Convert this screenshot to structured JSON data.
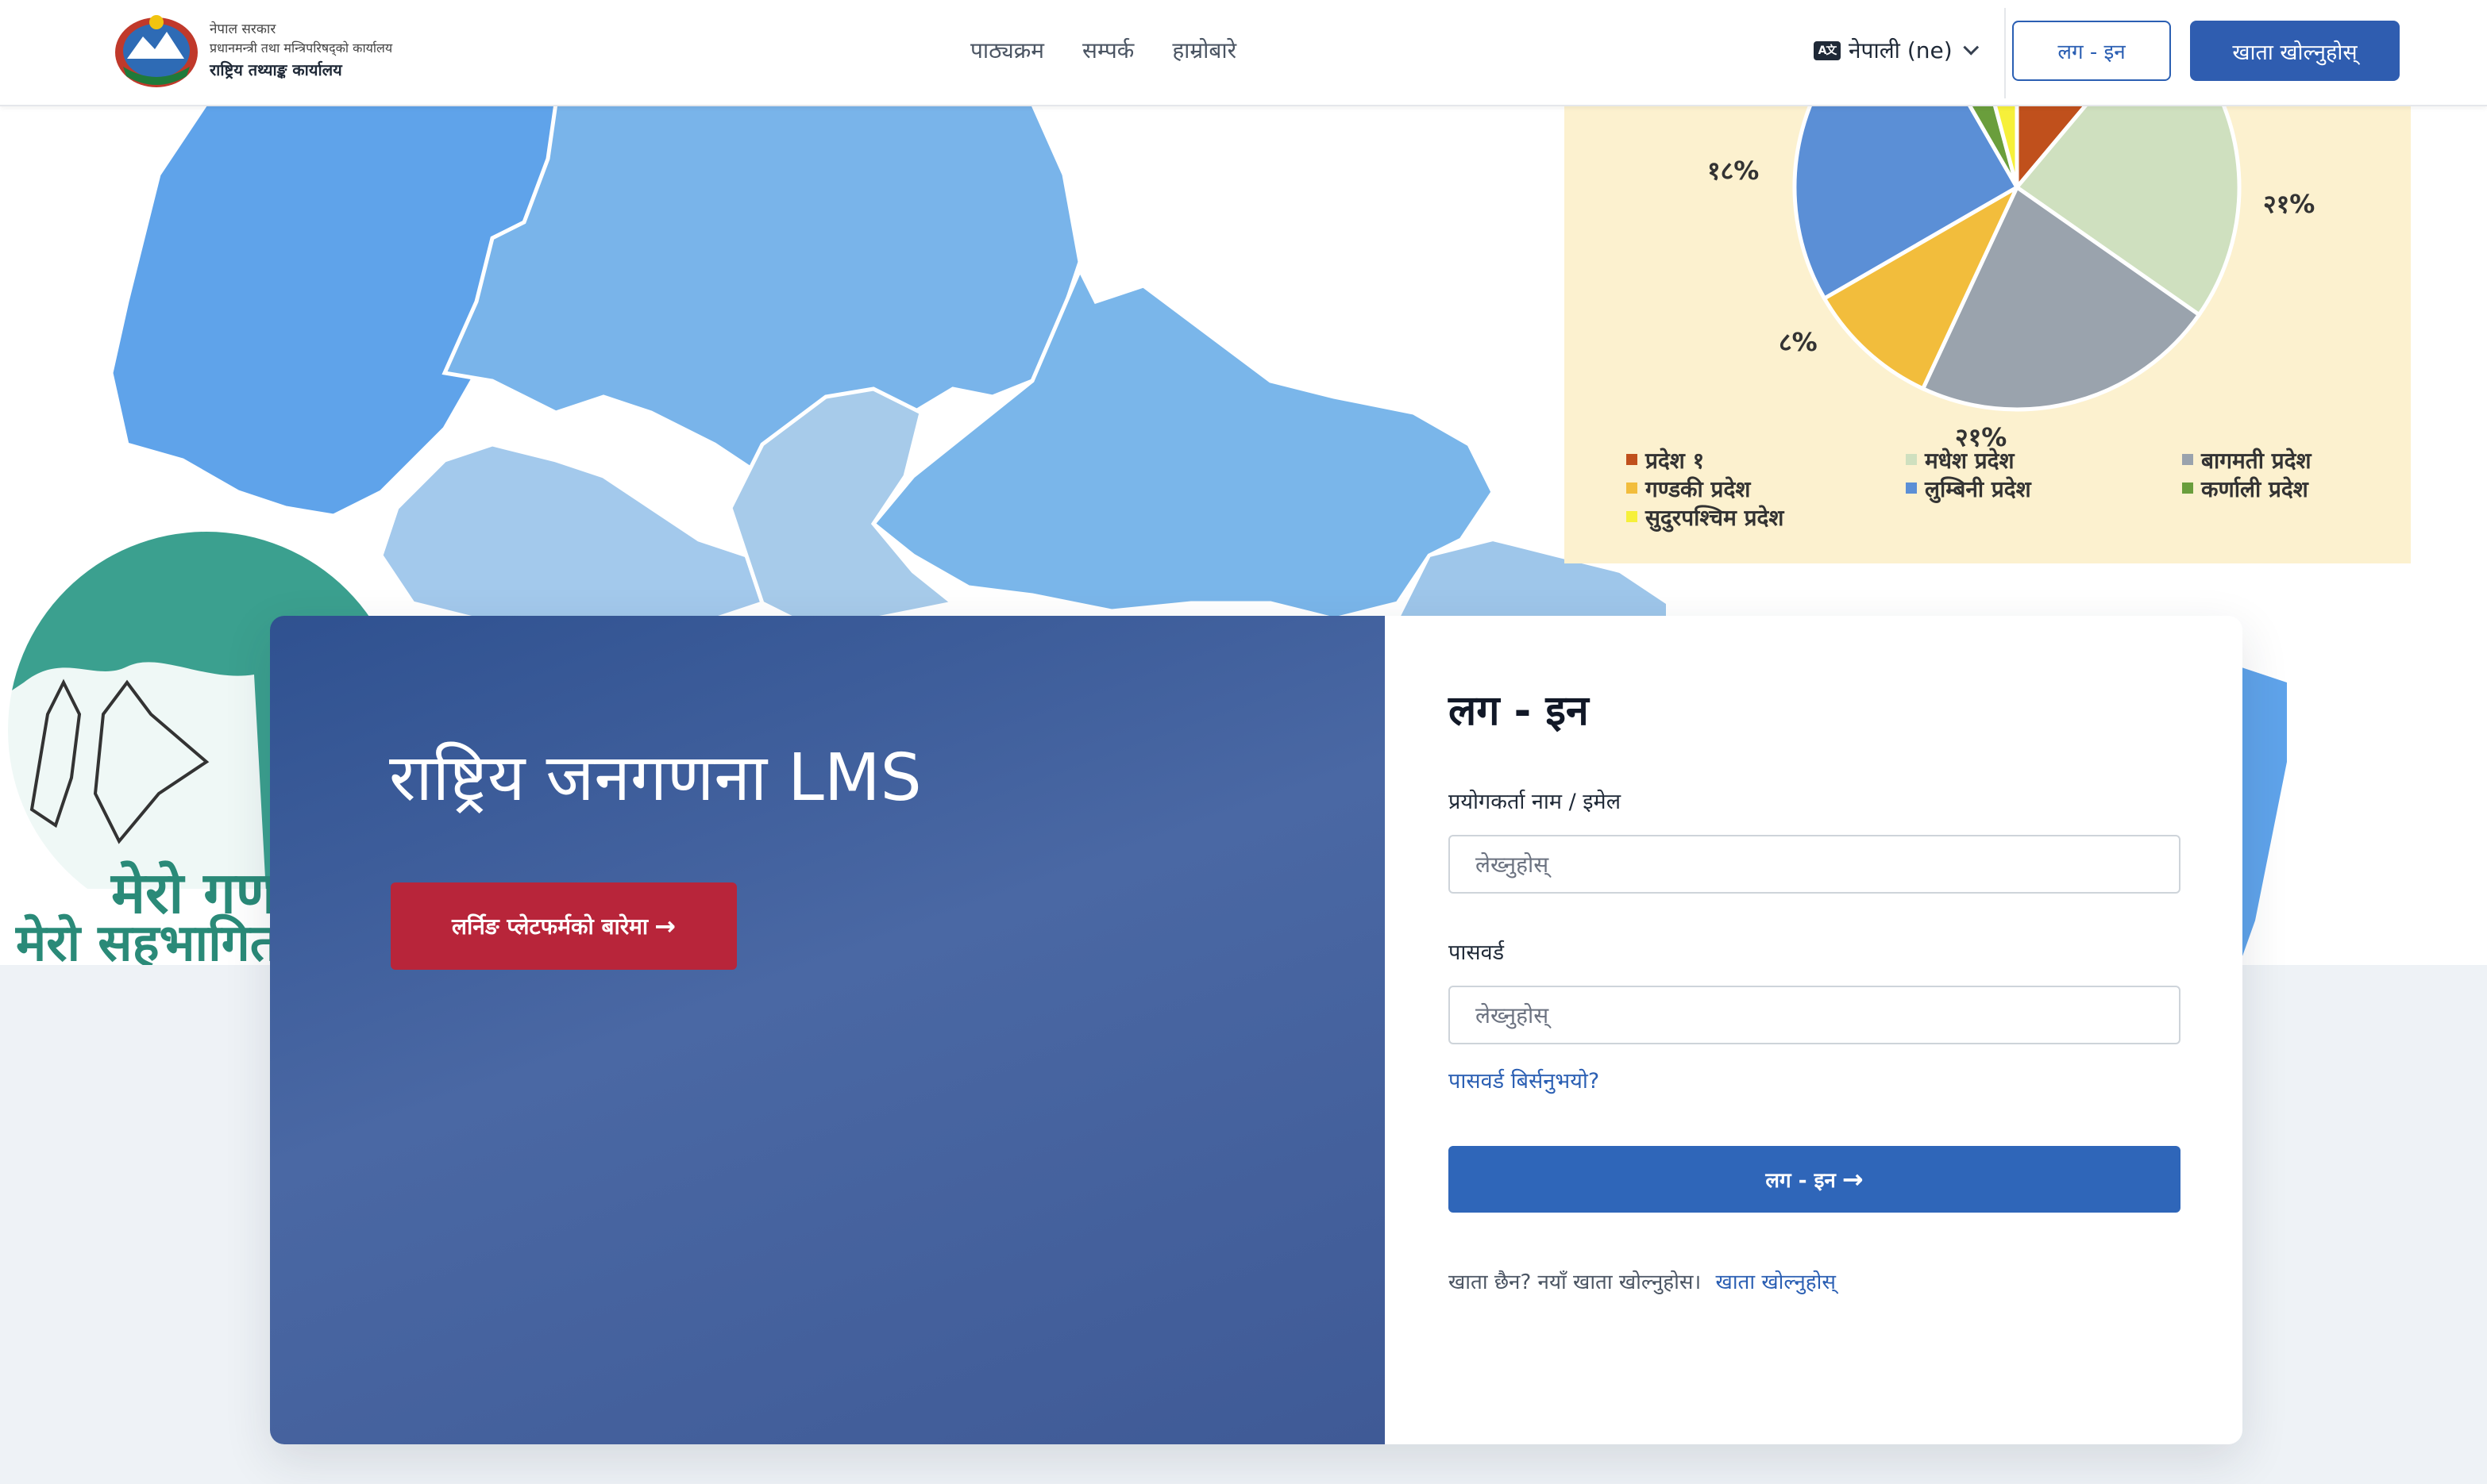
{
  "header": {
    "brand": {
      "line1": "नेपाल सरकार",
      "line2": "प्रधानमन्त्री तथा मन्त्रिपरिषद्को कार्यालय",
      "line3": "राष्ट्रिय तथ्याङ्क कार्यालय"
    },
    "nav": [
      {
        "label": "पाठ्यक्रम"
      },
      {
        "label": "सम्पर्क"
      },
      {
        "label": "हाम्रोबारे"
      }
    ],
    "language": {
      "icon_text": "A文",
      "label": "नेपाली (ne)"
    },
    "login_label": "लग - इन",
    "register_label": "खाता खोल्नुहोस्"
  },
  "hero": {
    "title": "राष्ट्रिय जनगणना LMS",
    "about_button": "लर्निङ प्लेटफर्मको बारेमा",
    "poster_text": [
      "मेरो गणना",
      "मेरो सहभागिता"
    ]
  },
  "chart_data": {
    "type": "pie",
    "labels": [
      "१८%",
      "२१%",
      "८%",
      "२१%"
    ],
    "legend": [
      {
        "name": "प्रदेश १",
        "color": "#c0501c"
      },
      {
        "name": "मधेश प्रदेश",
        "color": "#cfe0bf"
      },
      {
        "name": "बागमती प्रदेश",
        "color": "#9aa3ad"
      },
      {
        "name": "गण्डकी प्रदेश",
        "color": "#f2bd3c"
      },
      {
        "name": "लुम्बिनी प्रदेश",
        "color": "#5b8fd6"
      },
      {
        "name": "कर्णाली प्रदेश",
        "color": "#6a9e3c"
      },
      {
        "name": "सुदुरपश्चिम प्रदेश",
        "color": "#f6f03a"
      }
    ]
  },
  "login": {
    "title": "लग - इन",
    "username_label": "प्रयोगकर्ता नाम / इमेल",
    "username_placeholder": "लेख्नुहोस्",
    "password_label": "पासवर्ड",
    "password_placeholder": "लेख्नुहोस्",
    "forgot_label": "पासवर्ड बिर्सनुभयो?",
    "submit_label": "लग - इन",
    "signup_prompt": "खाता छैन? नयाँ खाता खोल्नुहोस।",
    "signup_link": "खाता खोल्नुहोस्"
  },
  "colors": {
    "primary": "#2f5db0",
    "danger": "#b8253a",
    "card_gradient": "#3f5a96"
  }
}
